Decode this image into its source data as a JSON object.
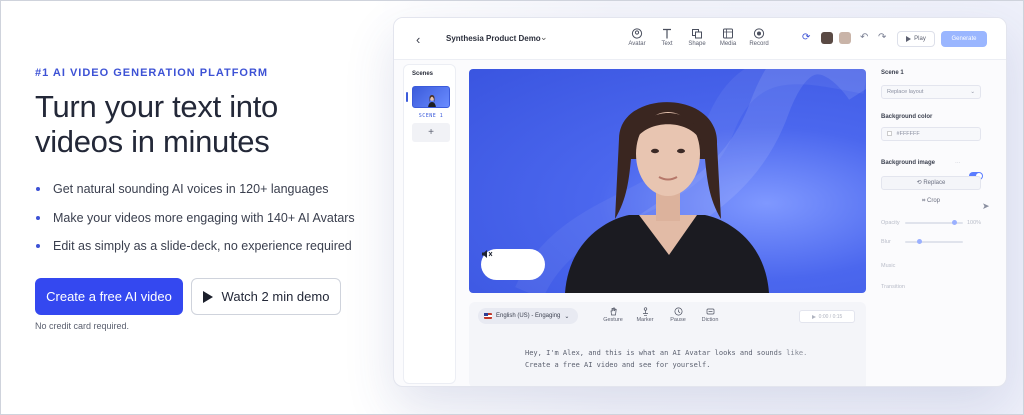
{
  "hero": {
    "eyebrow": "#1 AI VIDEO GENERATION PLATFORM",
    "headline_line1": "Turn your text into",
    "headline_line2": "videos in minutes",
    "bullets": [
      "Get natural sounding AI voices in 120+ languages",
      "Make your videos more engaging with 140+ AI Avatars",
      "Edit as simply as a slide-deck, no experience required"
    ],
    "primary_cta": "Create a free AI video",
    "secondary_cta": "Watch 2 min demo",
    "note": "No credit card required."
  },
  "editor": {
    "title": "Synthesia Product Demo",
    "toolbar": [
      {
        "label": "Avatar",
        "icon": "avatar-icon"
      },
      {
        "label": "Text",
        "icon": "text-icon"
      },
      {
        "label": "Shape",
        "icon": "shape-icon"
      },
      {
        "label": "Media",
        "icon": "media-icon"
      },
      {
        "label": "Record",
        "icon": "record-icon"
      }
    ],
    "play_label": "Play",
    "generate_label": "Generate",
    "scenes_title": "Scenes",
    "scene_label": "SCENE 1",
    "props": {
      "scene_title": "Scene 1",
      "layout_placeholder": "Replace layout",
      "bg_color_label": "Background color",
      "bg_color_value": "#FFFFFF",
      "bg_image_label": "Background image",
      "replace_label": "Replace",
      "crop_label": "Crop",
      "opacity_label": "Opacity",
      "opacity_value": "100%",
      "blur_label": "Blur",
      "music_label": "Music",
      "transition_label": "Transition"
    },
    "script": {
      "language": "English (US) - Engaging",
      "tools": [
        "Gesture",
        "Marker",
        "Pause",
        "Diction"
      ],
      "time": "0:00 / 0:15",
      "line1": "Hey, I'm Alex, and this is what an AI Avatar looks and sounds like.",
      "line2": "Create a free AI video and see for yourself."
    }
  },
  "colors": {
    "accent": "#3448F0",
    "eyebrow": "#3D52D5",
    "canvas_blue": "#4B67EE",
    "generate": "#9AB6FF"
  }
}
